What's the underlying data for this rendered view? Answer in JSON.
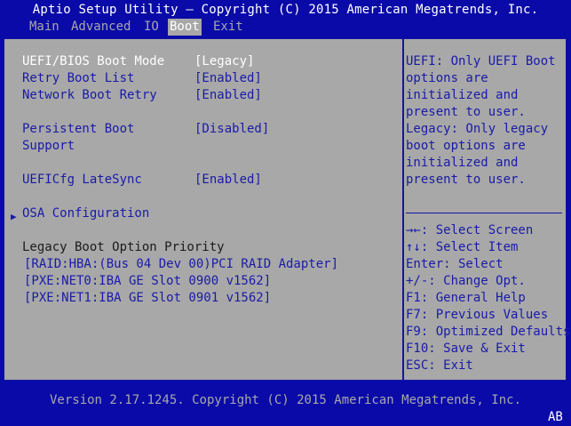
{
  "header": {
    "title": "Aptio Setup Utility – Copyright (C) 2015 American Megatrends, Inc.",
    "tabs": [
      "Main",
      "Advanced",
      "IO",
      "Boot",
      "Exit"
    ],
    "active_tab": "Boot"
  },
  "settings": {
    "uefi_boot_mode": {
      "label": "UEFI/BIOS Boot Mode",
      "value": "[Legacy]"
    },
    "retry_boot_list": {
      "label": "Retry Boot List",
      "value": "[Enabled]"
    },
    "network_boot_retry": {
      "label": "Network Boot Retry",
      "value": "[Enabled]"
    },
    "persistent_boot": {
      "label1": "Persistent Boot",
      "label2": "Support",
      "value": "[Disabled]"
    },
    "uefi_latesync": {
      "label": "UEFICfg LateSync",
      "value": "[Enabled]"
    },
    "osa_configuration": {
      "arrow": "▶",
      "label": "OSA Configuration"
    }
  },
  "legacy": {
    "heading": "Legacy Boot Option Priority",
    "items": [
      "[RAID:HBA:(Bus 04 Dev 00)PCI RAID Adapter]",
      "[PXE:NET0:IBA GE Slot 0900 v1562]",
      "[PXE:NET1:IBA GE Slot 0901 v1562]"
    ]
  },
  "help": {
    "description": [
      "UEFI: Only UEFI Boot",
      "options are",
      "initialized and",
      "present to user.",
      "Legacy: Only legacy",
      "boot options are",
      "initialized and",
      "present to user."
    ],
    "keys": [
      "→←: Select Screen",
      "↑↓: Select Item",
      "Enter: Select",
      "+/-: Change Opt.",
      "F1: General Help",
      "F7: Previous Values",
      "F9: Optimized Defaults",
      "F10: Save & Exit",
      "ESC: Exit"
    ]
  },
  "footer": {
    "version": "Version 2.17.1245. Copyright (C) 2015 American Megatrends, Inc.",
    "corner": "AB"
  }
}
